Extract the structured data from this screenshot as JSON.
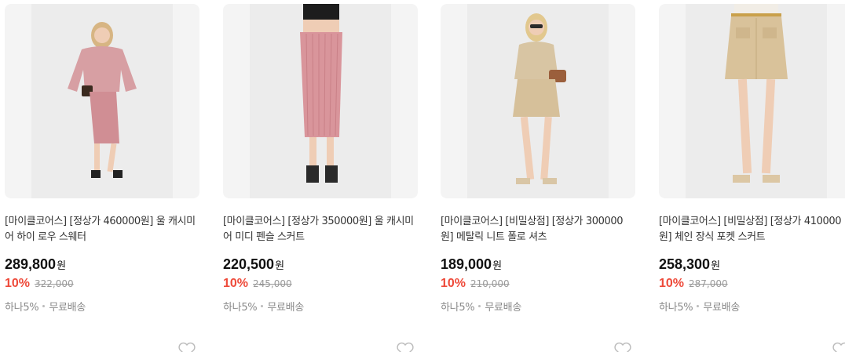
{
  "products": [
    {
      "title": "[마이클코어스] [정상가 460000원] 울 캐시미어 하이 로우 스웨터",
      "price": "289,800",
      "currency": "원",
      "discount_rate": "10%",
      "original_price": "322,000",
      "card_benefit": "하나5%",
      "shipping": "무료배송",
      "image_desc": "model in pink knit sweater and pencil skirt",
      "colors": {
        "bg": "#f4f4f4",
        "garment": "#d79fa3"
      }
    },
    {
      "title": "[마이클코어스] [정상가 350000원] 울 캐시미어 미디 펜슬 스커트",
      "price": "220,500",
      "currency": "원",
      "discount_rate": "10%",
      "original_price": "245,000",
      "card_benefit": "하나5%",
      "shipping": "무료배송",
      "image_desc": "model wearing pink ribbed midi pencil skirt",
      "colors": {
        "bg": "#f4f4f4",
        "garment": "#d9959b"
      }
    },
    {
      "title": "[마이클코어스] [비밀상점] [정상가 300000원] 메탈릭 니트 폴로 셔츠",
      "price": "189,000",
      "currency": "원",
      "discount_rate": "10%",
      "original_price": "210,000",
      "card_benefit": "하나5%",
      "shipping": "무료배송",
      "image_desc": "model in beige metallic knit polo and mini skirt",
      "colors": {
        "bg": "#f4f4f4",
        "garment": "#d8c5a3"
      }
    },
    {
      "title": "[마이클코어스] [비밀상점] [정상가 410000원] 체인 장식 포켓 스커트",
      "price": "258,300",
      "currency": "원",
      "discount_rate": "10%",
      "original_price": "287,000",
      "card_benefit": "하나5%",
      "shipping": "무료배송",
      "image_desc": "model wearing beige mini skirt with chain belt",
      "colors": {
        "bg": "#f4f4f4",
        "garment": "#d9c29a"
      }
    }
  ],
  "icons": {
    "wishlist": "heart-outline-icon"
  },
  "accent": {
    "discount": "#ee4a3a",
    "meta": "#8a8a8a"
  }
}
